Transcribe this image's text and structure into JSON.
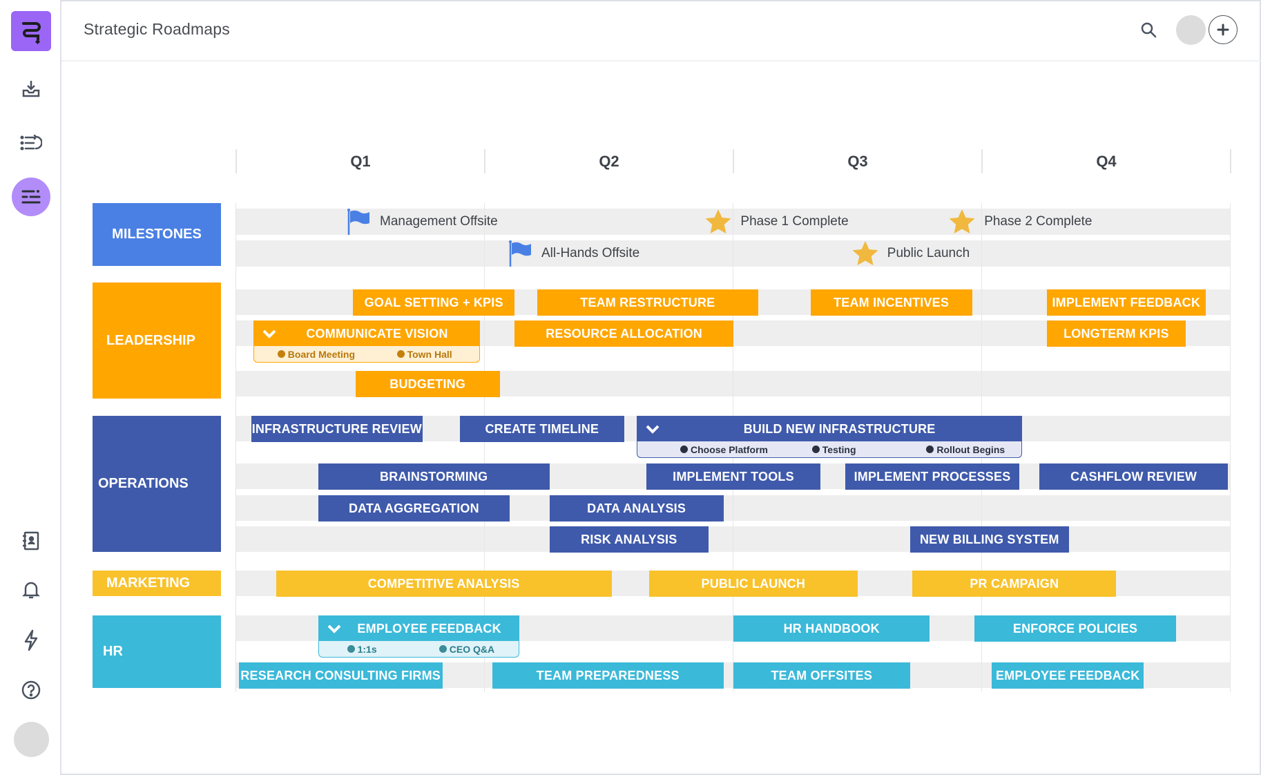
{
  "app": {
    "title": "Strategic Roadmaps"
  },
  "sidebar": {
    "items": [
      {
        "name": "import",
        "icon": "inbox-download-icon"
      },
      {
        "name": "list",
        "icon": "list-redo-icon"
      },
      {
        "name": "roadmap",
        "icon": "roadmap-icon",
        "active": true
      },
      {
        "name": "contacts",
        "icon": "contacts-book-icon"
      },
      {
        "name": "notifications",
        "icon": "bell-icon"
      },
      {
        "name": "automations",
        "icon": "lightning-icon"
      },
      {
        "name": "help",
        "icon": "help-circle-icon"
      }
    ]
  },
  "colors": {
    "milestones": "#4a80e4",
    "leadership": "#ffa600",
    "operations": "#3f5aab",
    "marketing": "#f9c22b",
    "hr": "#3bb9d9",
    "star": "#f0b83e",
    "flag": "#4a80e4"
  },
  "quarters": [
    "Q1",
    "Q2",
    "Q3",
    "Q4"
  ],
  "categories": [
    {
      "key": "milestones",
      "label": "MILESTONES"
    },
    {
      "key": "leadership",
      "label": "LEADERSHIP"
    },
    {
      "key": "operations",
      "label": "OPERATIONS"
    },
    {
      "key": "marketing",
      "label": "MARKETING"
    },
    {
      "key": "hr",
      "label": "HR"
    }
  ],
  "milestones": [
    {
      "label": "Management Offsite",
      "type": "flag",
      "row": 0,
      "at": 0.45
    },
    {
      "label": "Phase 1 Complete",
      "type": "star",
      "row": 0,
      "at": 1.94
    },
    {
      "label": "Phase 2 Complete",
      "type": "star",
      "row": 0,
      "at": 2.92
    },
    {
      "label": "All-Hands Offsite",
      "type": "flag",
      "row": 1,
      "at": 1.1
    },
    {
      "label": "Public Launch",
      "type": "star",
      "row": 1,
      "at": 2.53
    }
  ],
  "bars": {
    "leadership": [
      {
        "label": "GOAL SETTING + KPIS",
        "row": 0,
        "start": 0.47,
        "end": 1.12
      },
      {
        "label": "TEAM RESTRUCTURE",
        "row": 0,
        "start": 1.21,
        "end": 2.1
      },
      {
        "label": "TEAM INCENTIVES",
        "row": 0,
        "start": 2.31,
        "end": 2.96
      },
      {
        "label": "IMPLEMENT FEEDBACK",
        "row": 0,
        "start": 3.26,
        "end": 3.9
      },
      {
        "label": "COMMUNICATE VISION",
        "row": 1,
        "start": 0.07,
        "end": 0.98,
        "expanded": true,
        "subitems": [
          {
            "label": "Board Meeting",
            "at": 0.18
          },
          {
            "label": "Town Hall",
            "at": 0.66
          }
        ]
      },
      {
        "label": "RESOURCE ALLOCATION",
        "row": 1,
        "start": 1.12,
        "end": 2.0
      },
      {
        "label": "LONGTERM KPIS",
        "row": 1,
        "start": 3.26,
        "end": 3.82
      },
      {
        "label": "BUDGETING",
        "row": 2,
        "start": 0.48,
        "end": 1.06
      }
    ],
    "operations": [
      {
        "label": "INFRASTRUCTURE REVIEW",
        "row": 0,
        "start": 0.06,
        "end": 0.75
      },
      {
        "label": "CREATE TIMELINE",
        "row": 0,
        "start": 0.9,
        "end": 1.56
      },
      {
        "label": "BUILD NEW INFRASTRUCTURE",
        "row": 0,
        "start": 1.61,
        "end": 3.16,
        "expanded": true,
        "subitems": [
          {
            "label": "Choose Platform",
            "at": 1.8
          },
          {
            "label": "Testing",
            "at": 2.33
          },
          {
            "label": "Rollout Begins",
            "at": 2.79
          }
        ]
      },
      {
        "label": "BRAINSTORMING",
        "row": 1,
        "start": 0.33,
        "end": 1.26
      },
      {
        "label": "IMPLEMENT TOOLS",
        "row": 1,
        "start": 1.65,
        "end": 2.35
      },
      {
        "label": "IMPLEMENT PROCESSES",
        "row": 1,
        "start": 2.45,
        "end": 3.15
      },
      {
        "label": "CASHFLOW REVIEW",
        "row": 1,
        "start": 3.23,
        "end": 3.99
      },
      {
        "label": "DATA AGGREGATION",
        "row": 2,
        "start": 0.33,
        "end": 1.1
      },
      {
        "label": "DATA ANALYSIS",
        "row": 2,
        "start": 1.26,
        "end": 1.96
      },
      {
        "label": "RISK ANALYSIS",
        "row": 3,
        "start": 1.26,
        "end": 1.9
      },
      {
        "label": "NEW BILLING SYSTEM",
        "row": 3,
        "start": 2.71,
        "end": 3.35
      }
    ],
    "marketing": [
      {
        "label": "COMPETITIVE ANALYSIS",
        "row": 0,
        "start": 0.16,
        "end": 1.51
      },
      {
        "label": "PUBLIC LAUNCH",
        "row": 0,
        "start": 1.66,
        "end": 2.5
      },
      {
        "label": "PR CAMPAIGN",
        "row": 0,
        "start": 2.72,
        "end": 3.54
      }
    ],
    "hr": [
      {
        "label": "EMPLOYEE FEEDBACK",
        "row": 0,
        "start": 0.33,
        "end": 1.14,
        "expanded": true,
        "subitems": [
          {
            "label": "1:1s",
            "at": 0.46
          },
          {
            "label": "CEO Q&A",
            "at": 0.83
          }
        ]
      },
      {
        "label": "HR HANDBOOK",
        "row": 0,
        "start": 2.0,
        "end": 2.79
      },
      {
        "label": "ENFORCE POLICIES",
        "row": 0,
        "start": 2.97,
        "end": 3.78
      },
      {
        "label": "RESEARCH CONSULTING FIRMS",
        "row": 1,
        "start": 0.01,
        "end": 0.83
      },
      {
        "label": "TEAM PREPAREDNESS",
        "row": 1,
        "start": 1.03,
        "end": 1.96
      },
      {
        "label": "TEAM OFFSITES",
        "row": 1,
        "start": 2.0,
        "end": 2.71
      },
      {
        "label": "EMPLOYEE FEEDBACK",
        "row": 1,
        "start": 3.04,
        "end": 3.65
      }
    ]
  }
}
